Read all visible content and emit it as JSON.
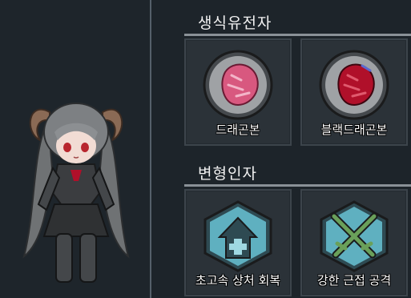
{
  "sections": {
    "genes": {
      "title": "생식유전자",
      "items": [
        {
          "label": "드래곤본",
          "icon": "dragon-bone-icon"
        },
        {
          "label": "블랙드래곤본",
          "icon": "black-dragon-bone-icon"
        }
      ]
    },
    "mutations": {
      "title": "변형인자",
      "items": [
        {
          "label": "초고속 상처 회복",
          "icon": "fast-healing-icon"
        },
        {
          "label": "강한 근접 공격",
          "icon": "strong-melee-icon"
        }
      ]
    }
  },
  "colors": {
    "background": "#1d242a",
    "card": "#2b3238",
    "divider": "#55606a",
    "dragon_bone": "#d8587f",
    "black_dragon_bone": "#b0102a",
    "mutation_icon": "#5fb0c0",
    "melee_green": "#6aa05a"
  }
}
